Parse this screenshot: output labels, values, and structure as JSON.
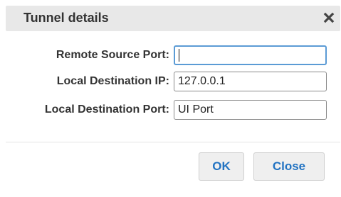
{
  "dialog": {
    "title": "Tunnel details",
    "close_icon": "close-icon"
  },
  "fields": [
    {
      "label": "Remote Source Port:",
      "value": "",
      "focused": true
    },
    {
      "label": "Local Destination IP:",
      "value": "127.0.0.1"
    },
    {
      "label": "Local Destination Port:",
      "value": "UI Port"
    }
  ],
  "buttons": {
    "ok_label": "OK",
    "close_label": "Close"
  },
  "colors": {
    "titlebar_bg": "#e8e8e8",
    "button_text": "#2273c2",
    "focus_border": "#5b9bd5"
  }
}
